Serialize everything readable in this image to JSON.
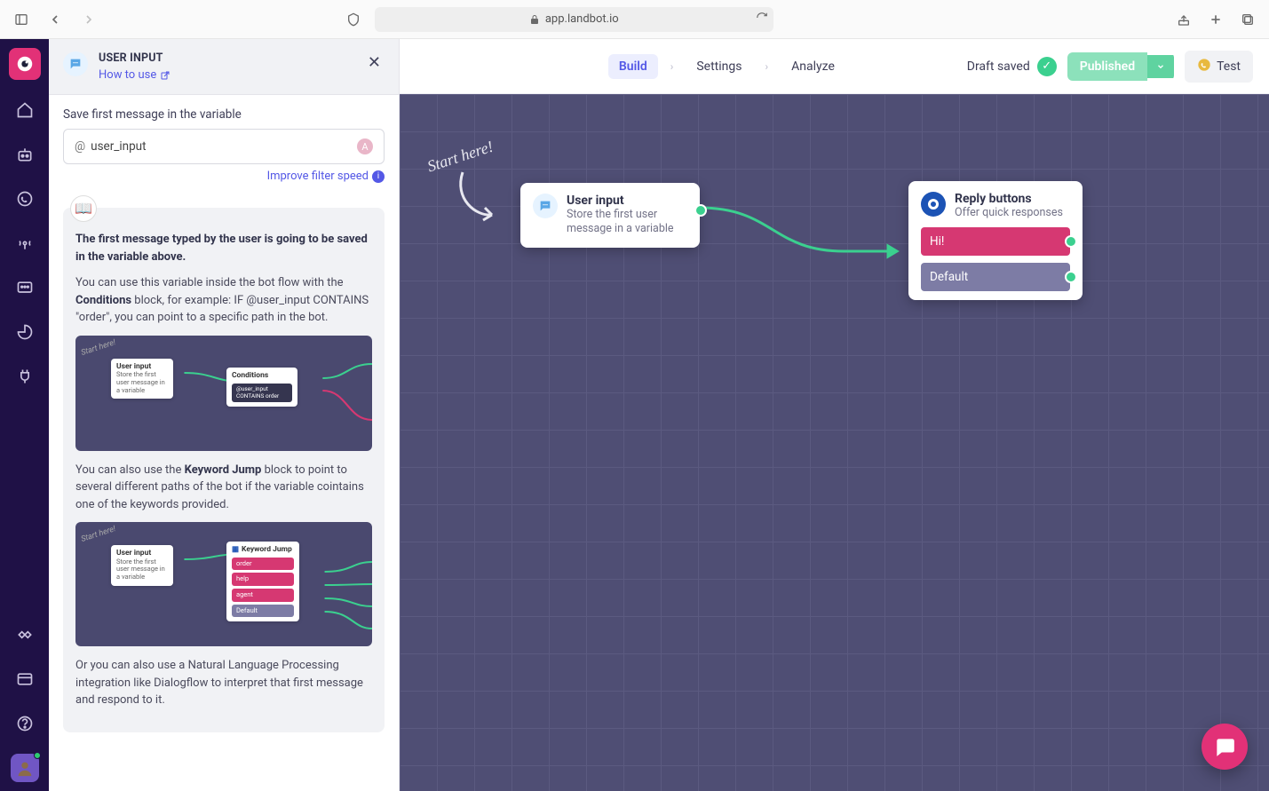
{
  "browser": {
    "url": "app.landbot.io"
  },
  "side_panel": {
    "title": "USER INPUT",
    "how_to_use": "How to use",
    "field_label": "Save first message in the variable",
    "variable_at": "@",
    "variable_name": "user_input",
    "badge_letter": "A",
    "improve_link": "Improve filter speed",
    "help": {
      "p1_bold": "The first message typed by the user is going to be saved in the variable above.",
      "p2_a": "You can use this variable inside the bot flow with the ",
      "p2_bold": "Conditions",
      "p2_b": " block, for example: IF @user_input CONTAINS \"order\", you can point to a specific path in the bot.",
      "thumb1": {
        "start_here": "Start here!",
        "user_input_title": "User input",
        "user_input_sub": "Store the first user message in a variable",
        "cond_title": "Conditions",
        "cond_expr": "@user_input CONTAINS order"
      },
      "p3_a": "You can also use the ",
      "p3_bold": "Keyword Jump",
      "p3_b": " block to point to several different paths of the bot if the variable cointains one of the keywords provided.",
      "thumb2": {
        "start_here": "Start here!",
        "user_input_title": "User input",
        "user_input_sub": "Store the first user message in a variable",
        "kj_title": "Keyword Jump",
        "kw1": "order",
        "kw2": "help",
        "kw3": "agent",
        "kw4": "Default"
      },
      "p4": "Or you can also use a Natural Language Processing integration like Dialogflow to interpret that first message and respond to it."
    }
  },
  "header": {
    "tabs": {
      "build": "Build",
      "settings": "Settings",
      "analyze": "Analyze"
    },
    "draft_saved": "Draft saved",
    "published": "Published",
    "test": "Test"
  },
  "canvas": {
    "start_here": "Start here!",
    "node1": {
      "title": "User input",
      "sub": "Store the first user message in a variable"
    },
    "node2": {
      "title": "Reply buttons",
      "sub": "Offer quick responses",
      "reply_hi": "Hi!",
      "reply_default": "Default"
    }
  }
}
